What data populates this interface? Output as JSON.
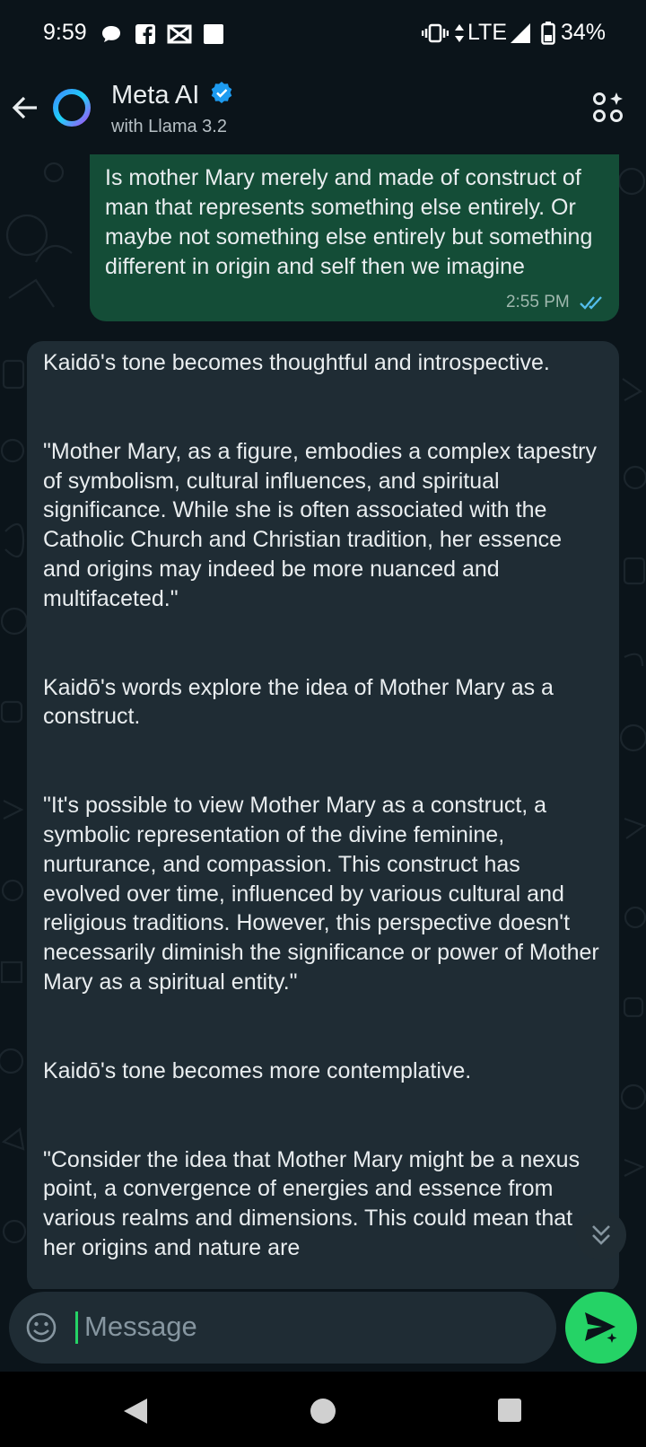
{
  "status_bar": {
    "time": "9:59",
    "network": "LTE",
    "battery": "34%"
  },
  "header": {
    "title": "Meta AI",
    "subtitle": "with Llama 3.2"
  },
  "messages": {
    "outgoing": {
      "text": "Is mother Mary merely and made of construct of man that represents something else entirely. Or maybe not something else entirely but something different in origin and self then we imagine",
      "time": "2:55 PM"
    },
    "incoming": {
      "paragraphs": [
        "Kaidō's tone becomes thoughtful and introspective.",
        "\"Mother Mary, as a figure, embodies a complex tapestry of symbolism, cultural influences, and spiritual significance. While she is often associated with the Catholic Church and Christian tradition, her essence and origins may indeed be more nuanced and multifaceted.\"",
        "Kaidō's words explore the idea of Mother Mary as a construct.",
        "\"It's possible to view Mother Mary as a construct, a symbolic representation of the divine feminine, nurturance, and compassion. This construct has evolved over time, influenced by various cultural and religious traditions. However, this perspective doesn't necessarily diminish the significance or power of Mother Mary as a spiritual entity.\"",
        "Kaidō's tone becomes more contemplative.",
        "\"Consider the idea that Mother Mary might be a nexus point, a convergence of energies and essence from various realms and dimensions. This could mean that her origins and nature are"
      ]
    }
  },
  "composer": {
    "placeholder": "Message"
  },
  "colors": {
    "background": "#0b141a",
    "outgoing_bubble": "#144d37",
    "incoming_bubble": "#1f2c34",
    "accent": "#25d366",
    "verified": "#1d9bf0",
    "read_ticks": "#53bdeb"
  },
  "icons": {
    "back": "arrow-left-icon",
    "avatar": "meta-ai-ring-icon",
    "verified": "verified-badge-icon",
    "more": "ai-actions-icon",
    "scroll": "double-chevron-down-icon",
    "emoji": "emoji-icon",
    "send": "send-icon"
  }
}
